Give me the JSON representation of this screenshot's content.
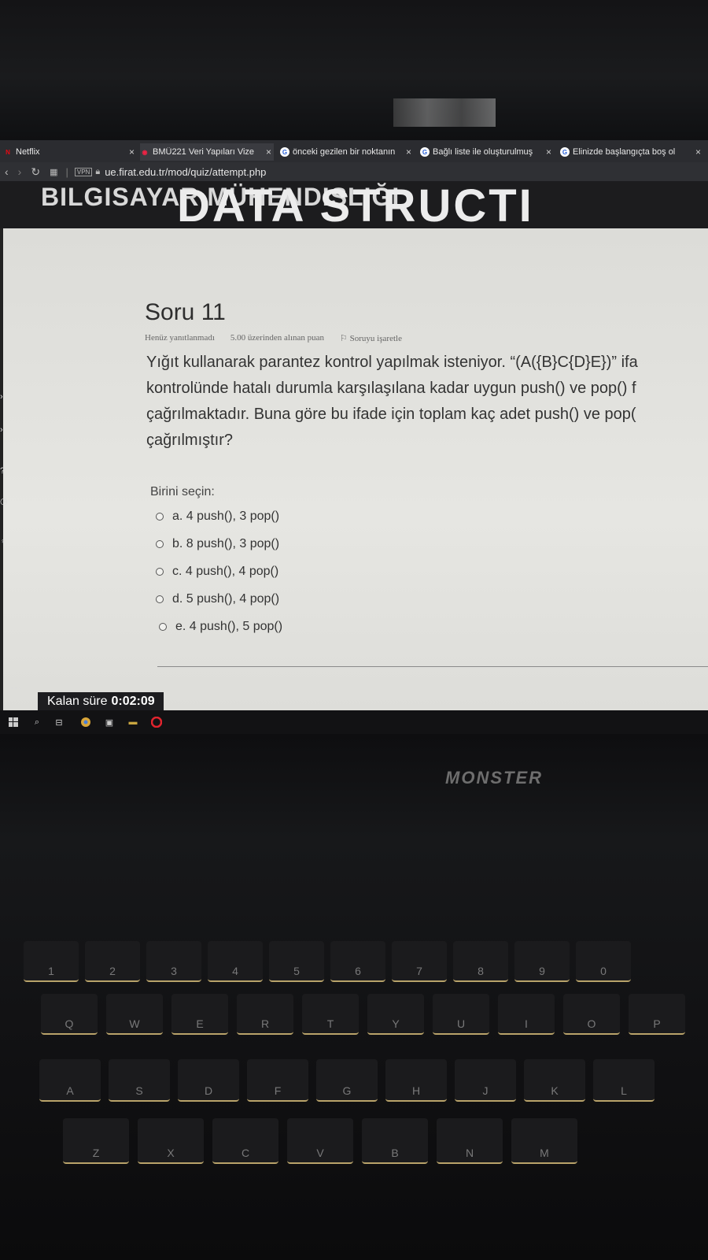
{
  "browser": {
    "tabs": [
      {
        "title": "Netflix",
        "fav": "N"
      },
      {
        "title": "BMÜ221 Veri Yapıları Vize",
        "fav": "◉",
        "active": true
      },
      {
        "title": "önceki gezilen bir noktanın",
        "fav": "G"
      },
      {
        "title": "Bağlı liste ile oluşturulmuş",
        "fav": "G"
      },
      {
        "title": "Elinizde başlangıçta boş ol",
        "fav": "G"
      }
    ],
    "close_glyph": "×",
    "url": "ue.firat.edu.tr/mod/quiz/attempt.php",
    "vpn_label": "VPN"
  },
  "banner": {
    "line1": "BILGISAYAR MÜHENDISLIĞI",
    "line2": "DATA STRUCTI"
  },
  "question": {
    "title": "Soru 11",
    "status": "Henüz yanıtlanmadı",
    "points": "5.00 üzerinden alınan puan",
    "flag": "Soruyu işaretle",
    "text": "Yığıt kullanarak parantez kontrol yapılmak isteniyor. “(A({B}C{D}E})” ifa\nkontrolünde hatalı durumla karşılaşılana kadar uygun push() ve pop() f\nçağrılmaktadır. Buna göre bu ifade için toplam kaç adet push() ve pop(\nçağrılmıştır?",
    "choose_label": "Birini seçin:",
    "options": [
      "a. 4 push(), 3 pop()",
      "b. 8 push(), 3 pop()",
      "c. 4 push(), 4 pop()",
      "d. 5 push(), 4 pop()",
      "e. 4 push(), 5 pop()"
    ]
  },
  "timer": {
    "label": "Kalan süre",
    "value": "0:02:09"
  },
  "laptop": {
    "brand": "MONSTER"
  },
  "keyboard": {
    "keys": [
      "1",
      "2",
      "3",
      "4",
      "5",
      "6",
      "7",
      "8",
      "9",
      "0",
      "Q",
      "W",
      "E",
      "R",
      "T",
      "Y",
      "U",
      "I",
      "O",
      "P",
      "A",
      "S",
      "D",
      "F",
      "G",
      "H",
      "J",
      "K",
      "L",
      "Z",
      "X",
      "C",
      "V",
      "B",
      "N",
      "M"
    ]
  }
}
